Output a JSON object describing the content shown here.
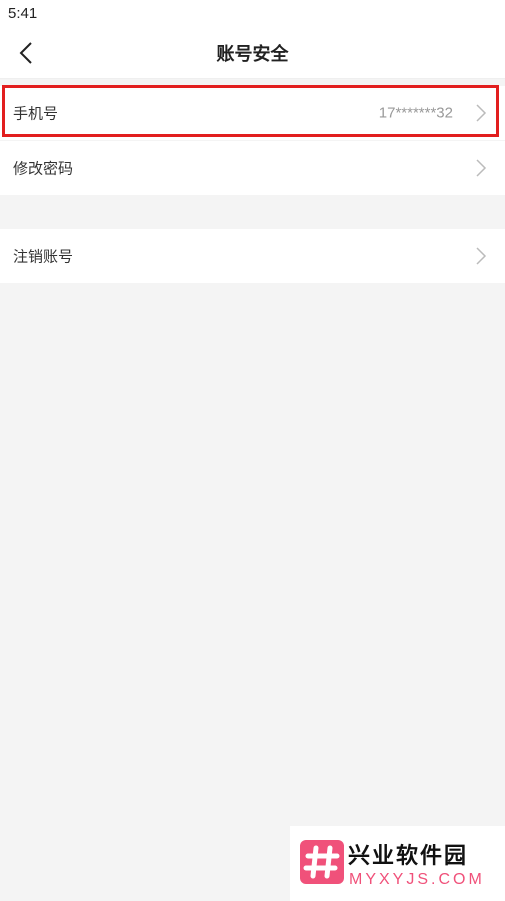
{
  "status_bar": {
    "time": "5:41"
  },
  "nav": {
    "title": "账号安全",
    "back_icon": "chevron-left-icon"
  },
  "settings": {
    "group1": [
      {
        "label": "手机号",
        "value": "17*******32",
        "icon": "chevron-right-icon"
      },
      {
        "label": "修改密码",
        "value": "",
        "icon": "chevron-right-icon"
      }
    ],
    "group2": [
      {
        "label": "注销账号",
        "value": "",
        "icon": "chevron-right-icon"
      }
    ]
  },
  "colors": {
    "highlight": "#e21e1e",
    "background": "#f4f4f4",
    "row_background": "#ffffff",
    "watermark_accent": "#f0517a"
  },
  "watermark": {
    "title": "兴业软件园",
    "subtitle": "MYXYJS.COM"
  }
}
